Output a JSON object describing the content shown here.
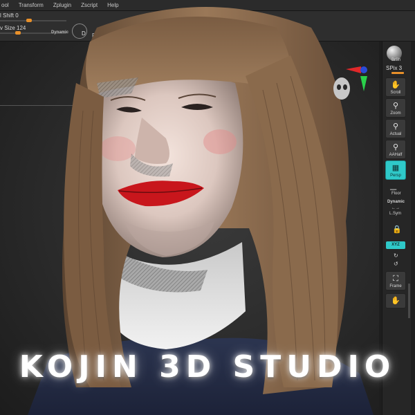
{
  "menu": {
    "items": [
      "ool",
      "Transform",
      "Zplugin",
      "Zscript",
      "Help"
    ]
  },
  "toolbar": {
    "shift_label": "l Shift 0",
    "draw_size_label": "v Size 124",
    "dynamic_label": "Dynamic",
    "gyro_label": "D",
    "re_label": "Rer"
  },
  "shelf": {
    "spix_label": "SPix 3",
    "brush_label": "BrSh",
    "buttons": {
      "scroll": "Scroll",
      "zoom": "Zoom",
      "actual": "Actual",
      "aahalf": "AAHalf",
      "persp": "Persp",
      "floor": "Floor",
      "local": "L.Sym",
      "frame": "Frame"
    },
    "dynamic_label": "Dynamic",
    "xyz_label": "XYZ"
  },
  "colors": {
    "accent_orange": "#e8902a",
    "accent_cyan": "#2fc9c9",
    "hair_brown": "#8a6a4c",
    "lip_red": "#c8161c",
    "axis_red": "#e0282a",
    "axis_green": "#2ad14a",
    "axis_blue": "#2b4bd8"
  },
  "overlay": {
    "title": "KOJIN 3D STUDIO"
  }
}
